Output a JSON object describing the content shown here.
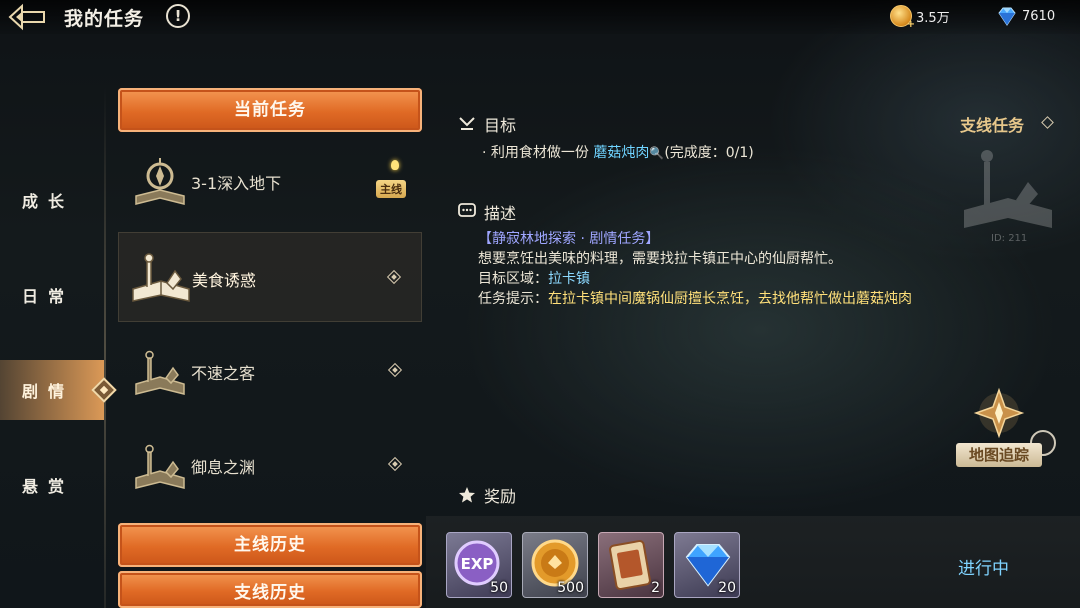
{
  "header": {
    "title": "我的任务",
    "help_symbol": "!",
    "coins": "3.5万",
    "gems": "7610"
  },
  "left_nav": {
    "items": [
      {
        "label": "成长",
        "active": false
      },
      {
        "label": "日常",
        "active": false
      },
      {
        "label": "剧情",
        "active": true
      },
      {
        "label": "悬赏",
        "active": false
      }
    ]
  },
  "quest_list": {
    "current_button": "当前任务",
    "main_history_button": "主线历史",
    "side_history_button": "支线历史",
    "items": [
      {
        "name": "3-1深入地下",
        "tag": "主线",
        "selected": false
      },
      {
        "name": "美食诱惑",
        "selected": true
      },
      {
        "name": "不速之客",
        "selected": false
      },
      {
        "name": "御息之渊",
        "selected": false
      }
    ]
  },
  "detail": {
    "goal_title": "目标",
    "branch_label": "支线任务",
    "goal_prefix": "· 利用食材做一份",
    "goal_item": "蘑菇炖肉",
    "goal_progress": "(完成度：0/1)",
    "desc_title": "描述",
    "desc_tag": "【静寂林地探索 · 剧情任务】",
    "desc_text": "想要烹饪出美味的料理，需要找拉卡镇正中心的仙厨帮忙。",
    "area_label": "目标区域：",
    "area_value": "拉卡镇",
    "hint_label": "任务提示：",
    "hint_value": "在拉卡镇中间魔锅仙厨擅长烹饪，去找他帮忙做出蘑菇炖肉",
    "watermark_id": "ID: 211",
    "track_button": "地图追踪"
  },
  "rewards": {
    "title": "奖励",
    "items": [
      {
        "icon": "exp-icon",
        "label": "EXP",
        "qty": "50"
      },
      {
        "icon": "gold-coin-icon",
        "qty": "500"
      },
      {
        "icon": "card-icon",
        "qty": "2"
      },
      {
        "icon": "diamond-icon",
        "qty": "20"
      }
    ],
    "status": "进行中"
  },
  "colors": {
    "accent_orange": "#e06a25",
    "link_blue": "#6fd3ff",
    "highlight_yellow": "#ffe07a",
    "tag_purple": "#9fa6ff"
  }
}
